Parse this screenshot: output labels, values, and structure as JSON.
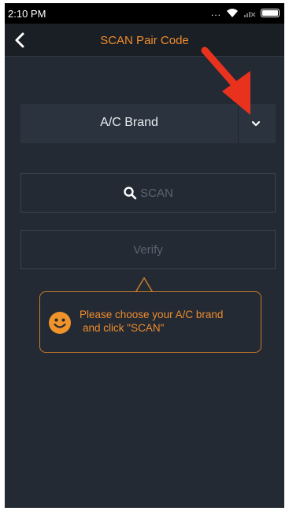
{
  "status_bar": {
    "time": "2:10 PM",
    "signal_text": "...",
    "icons": [
      "wifi-icon",
      "signal-off-icon",
      "battery-icon"
    ]
  },
  "header": {
    "title": "SCAN Pair Code",
    "back_icon": "chevron-left-icon"
  },
  "brand_select": {
    "label": "A/C Brand",
    "dropdown_icon": "chevron-down-icon"
  },
  "scan_button": {
    "label": "SCAN",
    "icon": "search-icon"
  },
  "verify_button": {
    "label": "Verify"
  },
  "tooltip": {
    "icon": "smiley-icon",
    "line1": "Please choose your A/C brand",
    "line2": "and click \"SCAN\""
  },
  "annotation": {
    "icon": "red-arrow-icon"
  },
  "colors": {
    "background": "#232a33",
    "header_background": "#1a1f25",
    "accent_orange": "#f08c2e",
    "annotation_red": "#e8321e",
    "muted_text": "#5a6472",
    "tooltip_border": "#c77a2c"
  }
}
